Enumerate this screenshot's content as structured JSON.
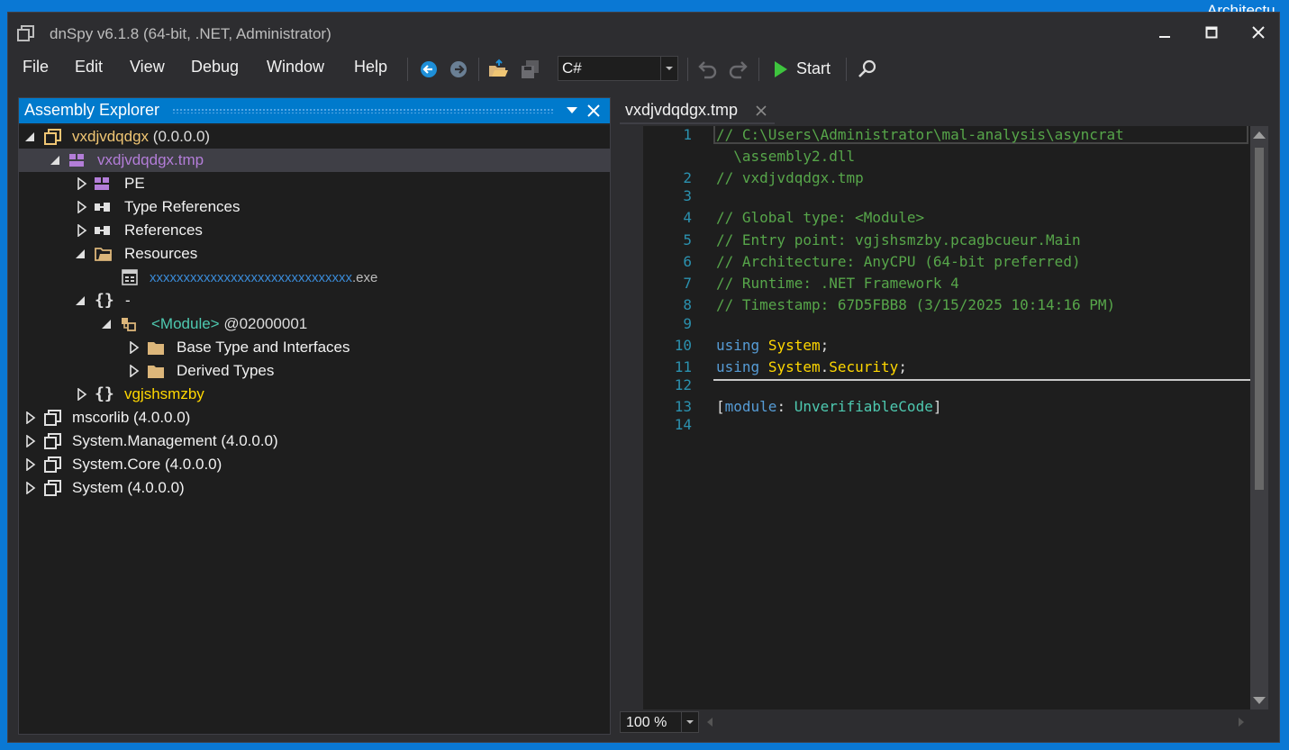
{
  "desktop": {
    "behind_text": "Architectu\ner\n:"
  },
  "window": {
    "title": "dnSpy v6.1.8 (64-bit, .NET, Administrator)",
    "controls": {
      "minimize": "minimize-icon",
      "maximize": "maximize-icon",
      "close": "close-icon"
    }
  },
  "menu": [
    "File",
    "Edit",
    "View",
    "Debug",
    "Window",
    "Help"
  ],
  "toolbar": {
    "language": "C#",
    "start_label": "Start",
    "accent": "#1e8fd8",
    "run_color": "#3ec43e"
  },
  "explorer": {
    "title": "Assembly Explorer",
    "header_color": "#007acc",
    "tree": [
      {
        "label": "vxdjvdqdgx",
        "suffix": " (0.0.0.0)",
        "color": "#f0c674",
        "icon": "assembly-icon",
        "expanded": true
      },
      {
        "label": "vxdjvdqdgx.tmp",
        "suffix": "",
        "color": "#b37dd8",
        "icon": "module-icon",
        "expanded": true,
        "selected": true
      },
      {
        "label": "PE",
        "suffix": "",
        "color": "#f1f1f1",
        "icon": "pe-icon",
        "expanded": false
      },
      {
        "label": "Type References",
        "suffix": "",
        "color": "#f1f1f1",
        "icon": "type-references-icon",
        "expanded": false
      },
      {
        "label": "References",
        "suffix": "",
        "color": "#f1f1f1",
        "icon": "references-icon",
        "expanded": false
      },
      {
        "label": "Resources",
        "suffix": "",
        "color": "#f1f1f1",
        "icon": "resources-folder-icon",
        "expanded": true
      },
      {
        "label": "xxxxxxxxxxxxxxxxxxxxxxxxxxxxxx",
        "suffix": ".exe",
        "color": "#3a8ad6",
        "icon": "resource-file-icon",
        "expanded": null
      },
      {
        "label": "-",
        "suffix": "",
        "color": "#f1f1f1",
        "icon": "namespace-icon",
        "expanded": true
      },
      {
        "label": "<Module>",
        "suffix": " @02000001",
        "color": "#4ec9b0",
        "icon": "class-module-icon",
        "expanded": true
      },
      {
        "label": "Base Type and Interfaces",
        "suffix": "",
        "color": "#f1f1f1",
        "icon": "folder-icon",
        "expanded": false
      },
      {
        "label": "Derived Types",
        "suffix": "",
        "color": "#f1f1f1",
        "icon": "folder-icon",
        "expanded": false
      },
      {
        "label": "vgjshsmzby",
        "suffix": "",
        "color": "#ffd700",
        "icon": "namespace-icon",
        "expanded": false
      },
      {
        "label": "mscorlib",
        "suffix": " (4.0.0.0)",
        "color": "#f1f1f1",
        "icon": "assembly-icon",
        "expanded": false
      },
      {
        "label": "System.Management",
        "suffix": " (4.0.0.0)",
        "color": "#f1f1f1",
        "icon": "assembly-icon",
        "expanded": false
      },
      {
        "label": "System.Core",
        "suffix": " (4.0.0.0)",
        "color": "#f1f1f1",
        "icon": "assembly-icon",
        "expanded": false
      },
      {
        "label": "System",
        "suffix": " (4.0.0.0)",
        "color": "#f1f1f1",
        "icon": "assembly-icon",
        "expanded": false
      }
    ]
  },
  "editor": {
    "tab_label": "vxdjvdqdgx.tmp",
    "zoom": "100 %",
    "lines": [
      {
        "n": "1",
        "parts": [
          {
            "t": "// C:\\Users\\Administrator\\mal-analysis\\asyncrat",
            "c": "com"
          }
        ]
      },
      {
        "n": "",
        "parts": [
          {
            "t": "  \\assembly2.dll",
            "c": "com"
          }
        ]
      },
      {
        "n": "2",
        "parts": [
          {
            "t": "// vxdjvdqdgx.tmp",
            "c": "com"
          }
        ]
      },
      {
        "n": "3",
        "parts": []
      },
      {
        "n": "4",
        "parts": [
          {
            "t": "// Global type: <Module>",
            "c": "com"
          }
        ]
      },
      {
        "n": "5",
        "parts": [
          {
            "t": "// Entry point: vgjshsmzby.pcagbcueur.Main",
            "c": "com"
          }
        ]
      },
      {
        "n": "6",
        "parts": [
          {
            "t": "// Architecture: AnyCPU (64-bit preferred)",
            "c": "com"
          }
        ]
      },
      {
        "n": "7",
        "parts": [
          {
            "t": "// Runtime: .NET Framework 4",
            "c": "com"
          }
        ]
      },
      {
        "n": "8",
        "parts": [
          {
            "t": "// Timestamp: 67D5FBB8 (3/15/2025 10:14:16 PM)",
            "c": "com"
          }
        ]
      },
      {
        "n": "9",
        "parts": []
      },
      {
        "n": "10",
        "parts": [
          {
            "t": "using",
            "c": "kw"
          },
          {
            "t": " ",
            "c": "plain"
          },
          {
            "t": "System",
            "c": "ns"
          },
          {
            "t": ";",
            "c": "plain"
          }
        ]
      },
      {
        "n": "11",
        "parts": [
          {
            "t": "using",
            "c": "kw"
          },
          {
            "t": " ",
            "c": "plain"
          },
          {
            "t": "System",
            "c": "ns"
          },
          {
            "t": ".",
            "c": "plain"
          },
          {
            "t": "Security",
            "c": "ns"
          },
          {
            "t": ";",
            "c": "plain"
          }
        ]
      },
      {
        "n": "12",
        "parts": []
      },
      {
        "n": "13",
        "parts": [
          {
            "t": "[",
            "c": "plain"
          },
          {
            "t": "module",
            "c": "kw"
          },
          {
            "t": ": ",
            "c": "plain"
          },
          {
            "t": "UnverifiableCode",
            "c": "type"
          },
          {
            "t": "]",
            "c": "plain"
          }
        ]
      },
      {
        "n": "14",
        "parts": []
      }
    ]
  }
}
